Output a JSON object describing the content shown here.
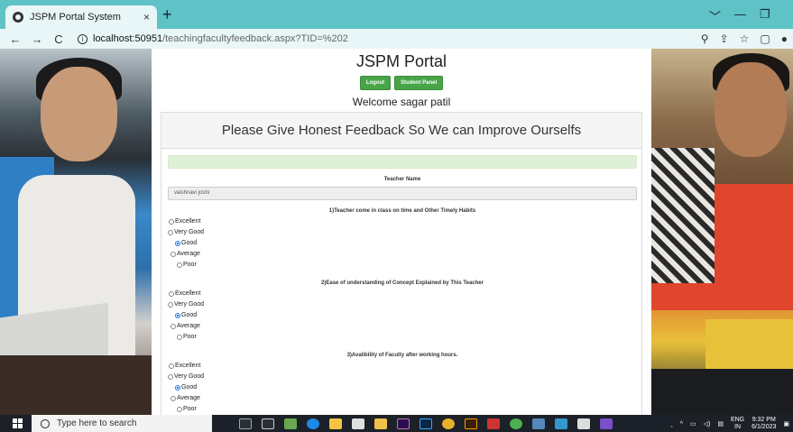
{
  "browser": {
    "tab_title": "JSPM Portal System",
    "tab_close": "×",
    "new_tab": "+",
    "win_min": "﹀",
    "win_minimize": "—",
    "win_restore": "❐",
    "url_host": "localhost:50951",
    "url_path": "/teachingfacultyfeedback.aspx?TID=%202",
    "back": "←",
    "forward": "→",
    "reload": "C"
  },
  "page": {
    "portal_title": "JSPM Portal",
    "logout_label": "Logout",
    "student_panel_label": "Student Panel",
    "welcome": "Welcome sagar patil",
    "panel_heading": "Please Give Honest Feedback So We can Improve Ourselfs",
    "teacher_label": "Teacher Name",
    "teacher_value": "vaishnavi joshi",
    "questions": [
      {
        "text": "1)Teacher come in class on time and Other Timely Habits",
        "options": [
          "Excellent",
          "Very Good",
          "Good",
          "Average",
          "Poor"
        ],
        "selected": "Good"
      },
      {
        "text": "2)Ease of understanding of Concept Explained by This Teacher",
        "options": [
          "Excellent",
          "Very Good",
          "Good",
          "Average",
          "Poor"
        ],
        "selected": "Good"
      },
      {
        "text": "3)Avalibility of Faculty after working hours.",
        "options": [
          "Excellent",
          "Very Good",
          "Good",
          "Average",
          "Poor"
        ],
        "selected": "Good"
      }
    ]
  },
  "taskbar": {
    "search_placeholder": "Type here to search",
    "lang": "ENG",
    "region": "IN",
    "time": "9:32 PM",
    "date": "6/1/2023"
  },
  "colors": {
    "tabbar": "#5fc2c6",
    "button_green": "#47a447",
    "alert_green": "#dff0d8",
    "taskbar": "#1c2129"
  }
}
